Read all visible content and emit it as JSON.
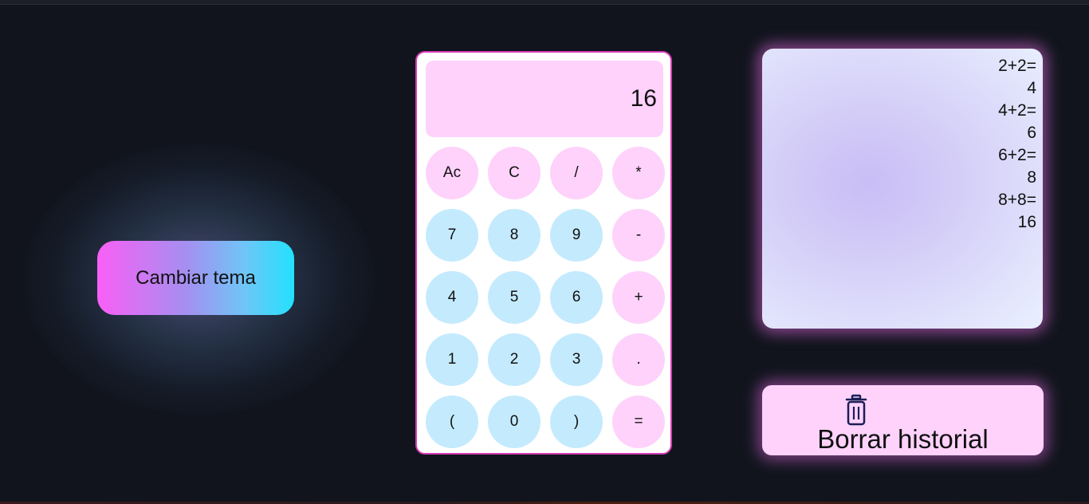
{
  "theme_button": {
    "label": "Cambiar tema"
  },
  "calculator": {
    "display": "16",
    "keys": [
      {
        "id": "all-clear",
        "label": "Ac",
        "style": "pink"
      },
      {
        "id": "clear",
        "label": "C",
        "style": "pink"
      },
      {
        "id": "divide",
        "label": "/",
        "style": "pink"
      },
      {
        "id": "multiply",
        "label": "*",
        "style": "pink"
      },
      {
        "id": "7",
        "label": "7",
        "style": "blue"
      },
      {
        "id": "8",
        "label": "8",
        "style": "blue"
      },
      {
        "id": "9",
        "label": "9",
        "style": "blue"
      },
      {
        "id": "subtract",
        "label": "-",
        "style": "pink"
      },
      {
        "id": "4",
        "label": "4",
        "style": "blue"
      },
      {
        "id": "5",
        "label": "5",
        "style": "blue"
      },
      {
        "id": "6",
        "label": "6",
        "style": "blue"
      },
      {
        "id": "add",
        "label": "+",
        "style": "pink"
      },
      {
        "id": "1",
        "label": "1",
        "style": "blue"
      },
      {
        "id": "2",
        "label": "2",
        "style": "blue"
      },
      {
        "id": "3",
        "label": "3",
        "style": "blue"
      },
      {
        "id": "decimal",
        "label": ".",
        "style": "pink"
      },
      {
        "id": "open-paren",
        "label": "(",
        "style": "blue"
      },
      {
        "id": "0",
        "label": "0",
        "style": "blue"
      },
      {
        "id": "close-paren",
        "label": ")",
        "style": "blue"
      },
      {
        "id": "equals",
        "label": "=",
        "style": "pink"
      }
    ]
  },
  "history": {
    "lines": [
      "2+2=",
      "4",
      "4+2=",
      "6",
      "6+2=",
      "8",
      "8+8=",
      "16"
    ]
  },
  "clear_history": {
    "label": "Borrar historial",
    "icon": "trash-icon"
  },
  "colors": {
    "background": "#11141d",
    "pink_key": "#fed2fb",
    "blue_key": "#c4eafd",
    "calc_border": "#d63cb4",
    "theme_gradient_start": "#f95ff6",
    "theme_gradient_end": "#23e1fd"
  }
}
